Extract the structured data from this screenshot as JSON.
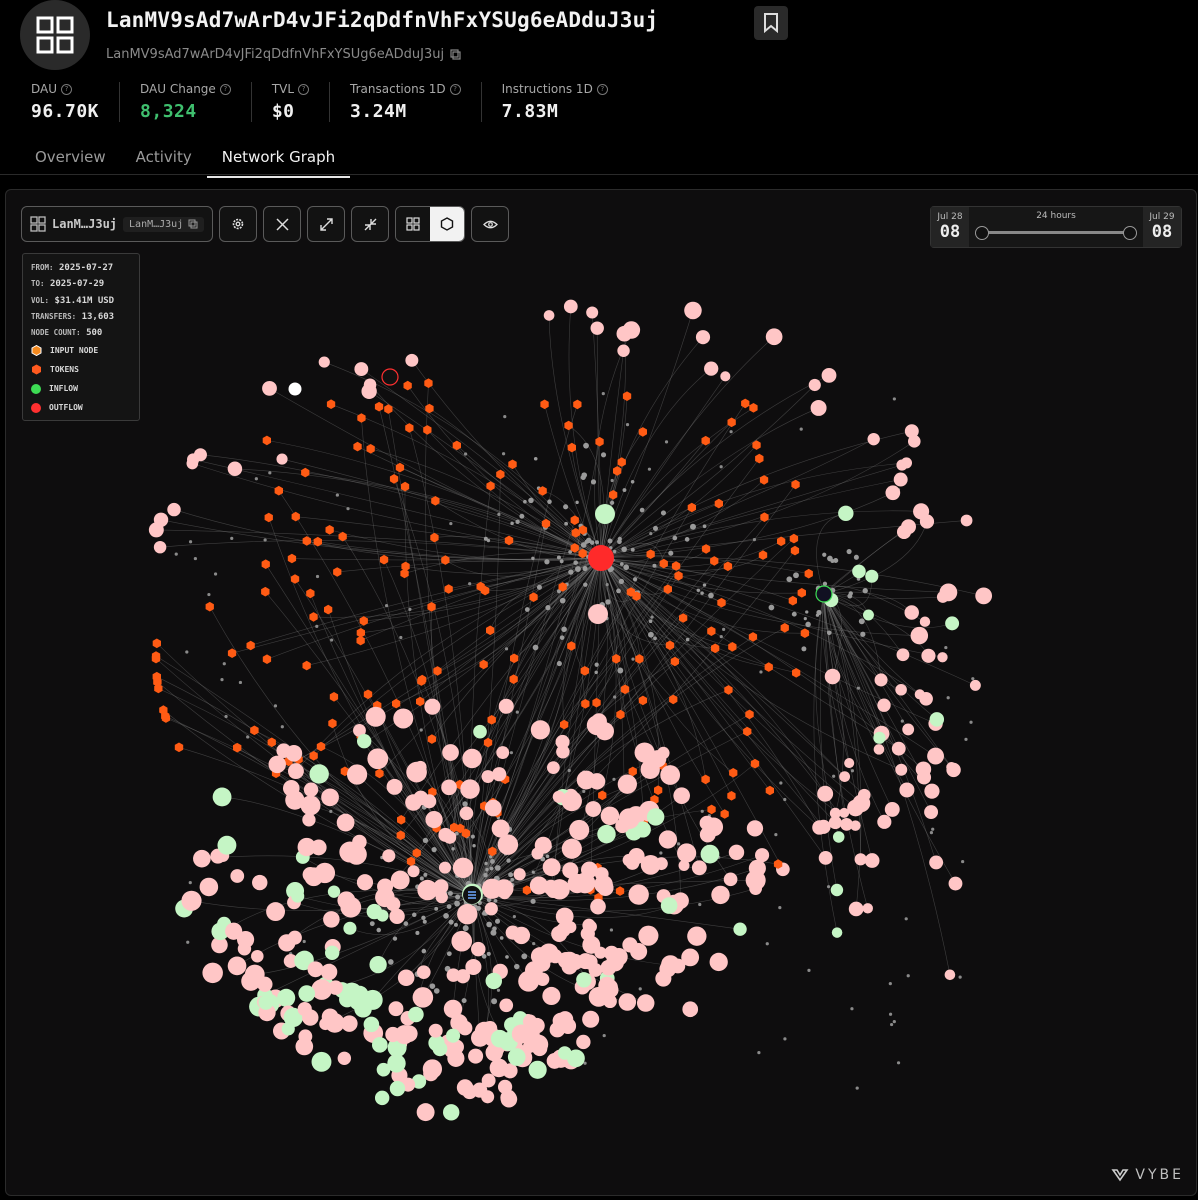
{
  "header": {
    "title": "LanMV9sAd7wArD4vJFi2qDdfnVhFxYSUg6eADduJ3uj",
    "address": "LanMV9sAd7wArD4vJFi2qDdfnVhFxYSUg6eADduJ3uj"
  },
  "stats": [
    {
      "label": "DAU",
      "value": "96.70K"
    },
    {
      "label": "DAU Change",
      "value": "8,324",
      "color": "#3fbf6e"
    },
    {
      "label": "TVL",
      "value": "$0"
    },
    {
      "label": "Transactions 1D",
      "value": "3.24M"
    },
    {
      "label": "Instructions 1D",
      "value": "7.83M"
    }
  ],
  "tabs": [
    {
      "label": "Overview",
      "active": false
    },
    {
      "label": "Activity",
      "active": false
    },
    {
      "label": "Network Graph",
      "active": true
    }
  ],
  "toolbar": {
    "address_short": "LanM…J3uj",
    "address_chip": "LanM…J3uj"
  },
  "legend": {
    "from_label": "FROM:",
    "from_value": "2025-07-27",
    "to_label": "TO:",
    "to_value": "2025-07-29",
    "vol_label": "VOL:",
    "vol_value": "$31.41M USD",
    "transfers_label": "TRANSFERS:",
    "transfers_value": "13,603",
    "nodecount_label": "NODE COUNT:",
    "nodecount_value": "500",
    "keys": [
      {
        "label": "INPUT NODE",
        "color": "#f58a1f"
      },
      {
        "label": "TOKENS",
        "color": "#ff5a1f"
      },
      {
        "label": "INFLOW",
        "color": "#3ddc54"
      },
      {
        "label": "OUTFLOW",
        "color": "#ff3030"
      }
    ]
  },
  "timerange": {
    "start_month": "Jul 28",
    "start_day": "08",
    "duration": "24 hours",
    "end_month": "Jul 29",
    "end_day": "08"
  },
  "brand": "VYBE",
  "colors": {
    "token": "#ff5b14",
    "outflow_node": "#ffc6c6",
    "inflow_node": "#c5f5c5",
    "hub": "#ff2a2a",
    "edge": "#7a7a7a"
  }
}
